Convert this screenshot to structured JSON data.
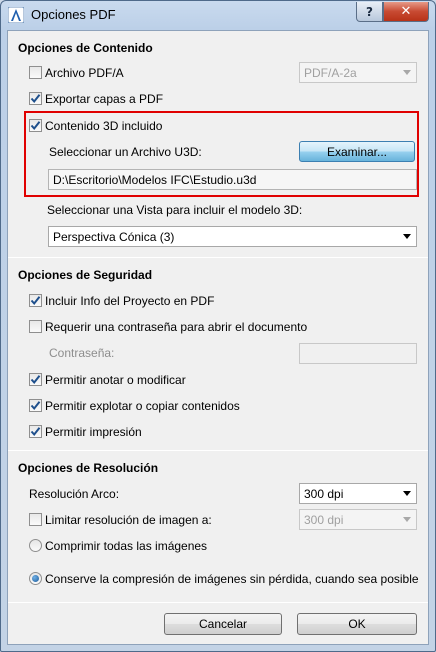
{
  "window": {
    "title": "Opciones PDF",
    "help_label": "?",
    "close_label": "✕"
  },
  "content_section": {
    "title": "Opciones de Contenido",
    "pdfa": {
      "label": "Archivo PDF/A",
      "checked": false,
      "select_value": "PDF/A-2a"
    },
    "export_layers": {
      "label": "Exportar capas a PDF",
      "checked": true
    },
    "include_3d": {
      "label": "Contenido 3D incluido",
      "checked": true
    },
    "u3d": {
      "label": "Seleccionar un Archivo U3D:",
      "browse_label": "Examinar...",
      "path": "D:\\Escritorio\\Modelos IFC\\Estudio.u3d"
    },
    "view": {
      "label": "Seleccionar una Vista para incluir el modelo 3D:",
      "value": "Perspectiva Cónica (3)"
    }
  },
  "security_section": {
    "title": "Opciones de Seguridad",
    "project_info": {
      "label": "Incluir Info del Proyecto en PDF",
      "checked": true
    },
    "require_password": {
      "label": "Requerir una contraseña para abrir el documento",
      "checked": false
    },
    "password": {
      "label": "Contraseña:",
      "value": ""
    },
    "allow_annotate": {
      "label": "Permitir anotar o modificar",
      "checked": true
    },
    "allow_extract": {
      "label": "Permitir explotar o copiar contenidos",
      "checked": true
    },
    "allow_print": {
      "label": "Permitir impresión",
      "checked": true
    }
  },
  "resolution_section": {
    "title": "Opciones de Resolución",
    "arc_resolution": {
      "label": "Resolución Arco:",
      "value": "300 dpi"
    },
    "limit_image": {
      "label": "Limitar resolución de imagen a:",
      "checked": false,
      "value": "300 dpi"
    },
    "compress_all": {
      "label": "Comprimir todas las imágenes",
      "selected": false
    },
    "lossless": {
      "label": "Conserve la compresión de imágenes sin pérdida, cuando sea posible",
      "selected": true
    }
  },
  "buttons": {
    "cancel": "Cancelar",
    "ok": "OK"
  },
  "colors": {
    "highlight": "#e00000",
    "check_mark": "#1e4f8c",
    "title_bar": "#bcd0e8"
  }
}
